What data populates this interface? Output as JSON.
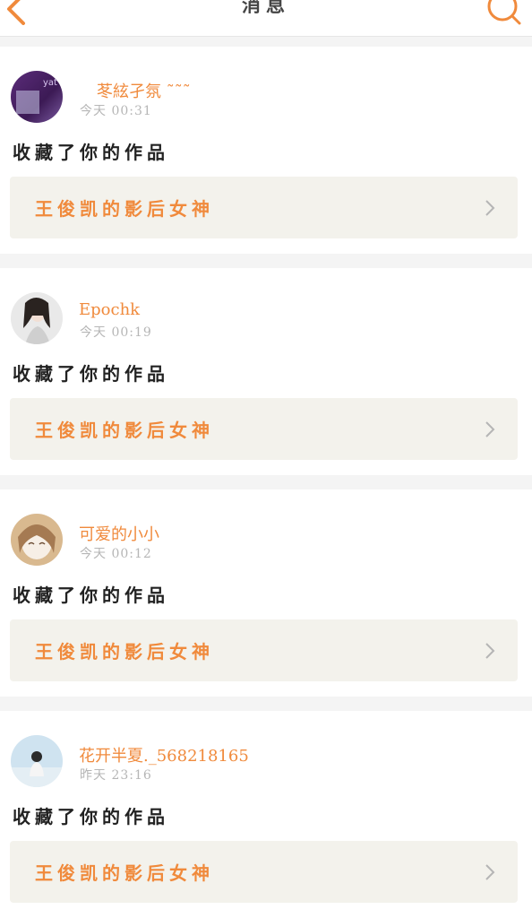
{
  "header": {
    "title": "消息",
    "back_icon": "chevron-left-icon",
    "search_icon": "search-icon"
  },
  "colors": {
    "accent": "#f08a3c",
    "background": "#f4f4f4",
    "card": "#ffffff",
    "work_box": "#f3f2ec"
  },
  "messages": [
    {
      "username": "苳絃孑氛 ˜˜˜",
      "time": "今天 00:31",
      "action": "收藏了你的作品",
      "work_title": "王俊凯的影后女神"
    },
    {
      "username": "Epochk",
      "time": "今天 00:19",
      "action": "收藏了你的作品",
      "work_title": "王俊凯的影后女神"
    },
    {
      "username": "可爱的小小",
      "time": "今天 00:12",
      "action": "收藏了你的作品",
      "work_title": "王俊凯的影后女神"
    },
    {
      "username": "花开半夏._568218165",
      "time": "昨天 23:16",
      "action": "收藏了你的作品",
      "work_title": "王俊凯的影后女神"
    }
  ]
}
